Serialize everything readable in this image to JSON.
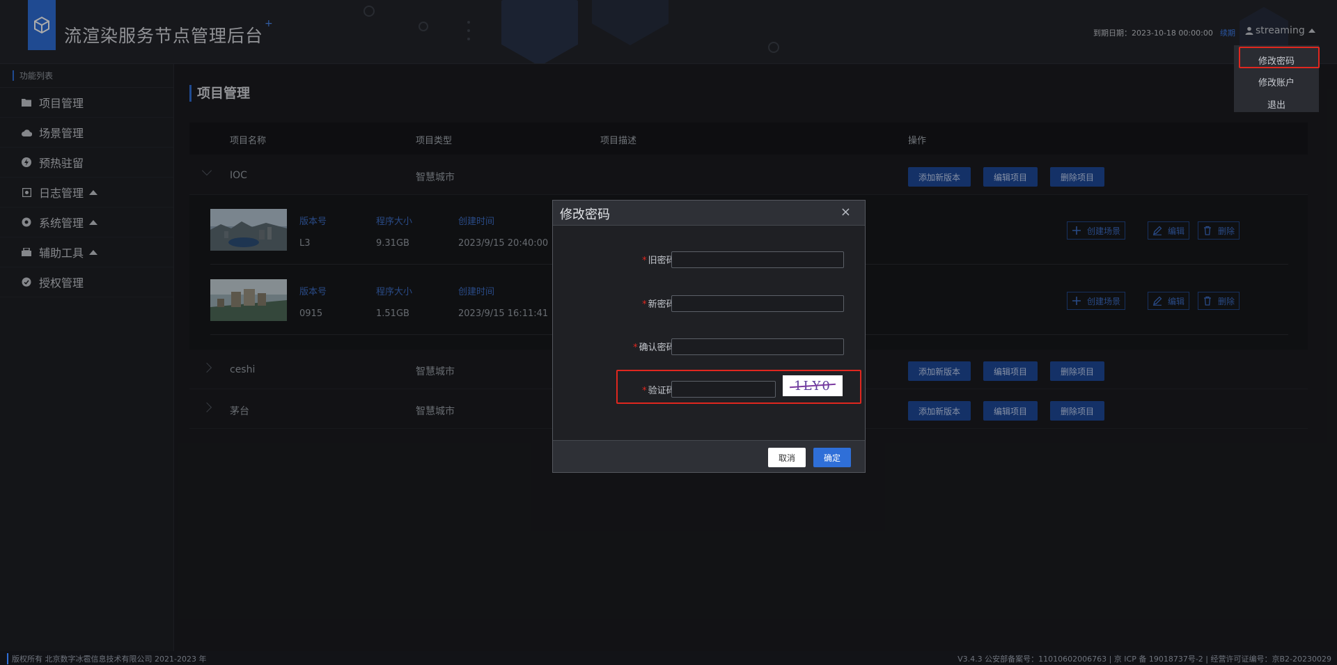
{
  "header": {
    "app_title": "流渲染服务节点管理后台",
    "title_plus": "+",
    "expire_text": "到期日期：2023-10-18 00:00:00",
    "renew_label": "续期",
    "username": "streaming"
  },
  "user_menu": {
    "items": [
      {
        "label": "修改密码"
      },
      {
        "label": "修改账户"
      },
      {
        "label": "退出"
      }
    ]
  },
  "sidebar": {
    "header": "功能列表",
    "items": [
      {
        "label": "项目管理",
        "icon": "folder-icon"
      },
      {
        "label": "场景管理",
        "icon": "cloud-icon"
      },
      {
        "label": "预热驻留",
        "icon": "bolt-icon"
      },
      {
        "label": "日志管理",
        "icon": "log-icon"
      },
      {
        "label": "系统管理",
        "icon": "gear-icon"
      },
      {
        "label": "辅助工具",
        "icon": "tool-icon"
      },
      {
        "label": "授权管理",
        "icon": "shield-icon"
      }
    ]
  },
  "main": {
    "title": "项目管理",
    "columns": [
      "项目名称",
      "项目类型",
      "项目描述",
      "操作"
    ],
    "row_actions": {
      "add_version": "添加新版本",
      "edit_project": "编辑项目",
      "delete_project": "删除项目"
    },
    "projects": [
      {
        "name": "IOC",
        "type": "智慧城市"
      },
      {
        "name": "ceshi",
        "type": "智慧城市"
      },
      {
        "name": "茅台",
        "type": "智慧城市"
      }
    ],
    "version_labels": {
      "version": "版本号",
      "size": "程序大小",
      "created": "创建时间"
    },
    "version_actions": {
      "create_scene": "创建场景",
      "edit": "编辑",
      "delete": "删除"
    },
    "versions": [
      {
        "version": "L3",
        "size": "9.31GB",
        "created": "2023/9/15 20:40:00"
      },
      {
        "version": "0915",
        "size": "1.51GB",
        "created": "2023/9/15 16:11:41"
      }
    ]
  },
  "modal": {
    "title": "修改密码",
    "close_symbol": "×",
    "required_mark": "*",
    "fields": {
      "old_password": "旧密码:",
      "new_password": "新密码:",
      "confirm_password": "确认密码:",
      "captcha": "验证码:"
    },
    "captcha_text": "1LY0",
    "cancel_label": "取消",
    "ok_label": "确定"
  },
  "footer": {
    "copyright": "版权所有 北京数字冰雹信息技术有限公司 2021-2023 年",
    "right": "V3.4.3 公安部备案号：11010602006763 | 京 ICP 备 19018737号-2 | 经营许可证编号：京B2-20230029"
  },
  "colors": {
    "accent": "#2f6fd8",
    "highlight": "#e0271f",
    "background": "#1b1c20"
  }
}
